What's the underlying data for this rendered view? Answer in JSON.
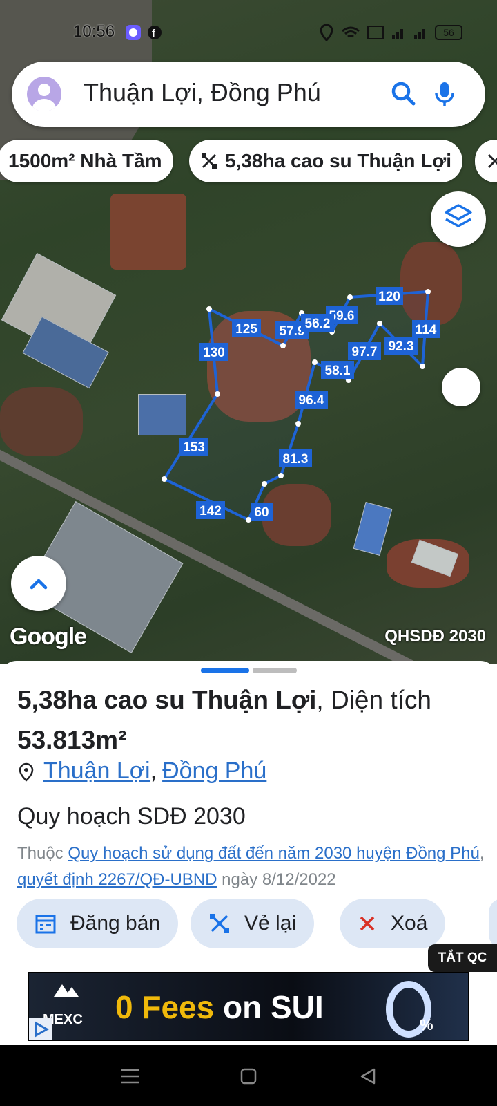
{
  "status_bar": {
    "time": "10:56",
    "battery": "56"
  },
  "search": {
    "query": "Thuận Lợi, Đồng Phú"
  },
  "chips": [
    {
      "label": "1500m² Nhà Tầm"
    },
    {
      "label": "5,38ha cao su Thuận Lợi"
    }
  ],
  "map": {
    "google_label": "Google",
    "layer_name": "QHSDĐ 2030",
    "parcel_color": "#1e63d6",
    "edge_labels": [
      "120",
      "59.6",
      "114",
      "125",
      "57.9",
      "56.2",
      "92.3",
      "130",
      "97.7",
      "58.1",
      "96.4",
      "153",
      "81.3",
      "142",
      "60"
    ]
  },
  "parcel": {
    "title_bold": "5,38ha cao su Thuận Lợi",
    "title_rest": ", Diện tích",
    "area": "53.813m²",
    "ward": "Thuận Lợi",
    "separator": ",",
    "district": "Đồng Phú",
    "plan_title": "Quy hoạch SDĐ 2030",
    "plan_prefix": "Thuộc",
    "plan_link1": "Quy hoạch sử dụng đất đến năm 2030 huyện Đồng Phú",
    "plan_comma": ",",
    "plan_link2": "quyết định 2267/QĐ-UBND",
    "plan_date": "ngày 8/12/2022"
  },
  "actions": {
    "post": "Đăng bán",
    "redraw": "Vẻ lại",
    "delete": "Xoá"
  },
  "ad": {
    "toggle": "TẮT QC",
    "brand": "MEXC",
    "headline_a": "0 Fees",
    "headline_b": " on SUI"
  },
  "colors": {
    "accent": "#1a73e8",
    "button_bg": "#dde7f5",
    "link": "#2a6fc9"
  }
}
